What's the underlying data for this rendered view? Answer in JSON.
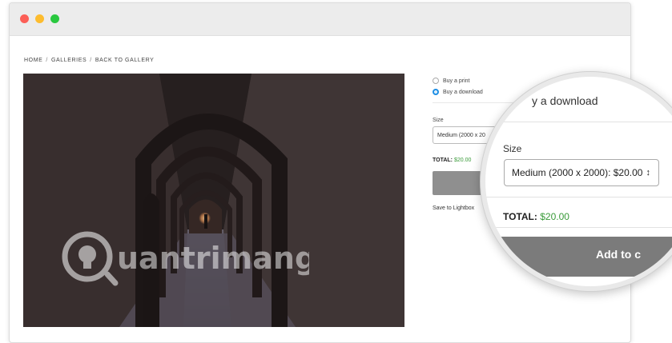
{
  "window": {
    "controls": [
      "close",
      "minimize",
      "maximize"
    ],
    "colors": {
      "close": "#fc5f57",
      "minimize": "#fdbc2e",
      "maximize": "#29c83f"
    }
  },
  "breadcrumb": {
    "items": [
      "HOME",
      "GALLERIES",
      "BACK TO GALLERY"
    ],
    "separator": "/"
  },
  "photo": {
    "icon": "archway-photo"
  },
  "purchase": {
    "options": [
      {
        "label": "Buy a print",
        "checked": false
      },
      {
        "label": "Buy a download",
        "checked": true
      }
    ],
    "size_label": "Size",
    "size_value": "Medium (2000 x 20",
    "total_label": "TOTAL:",
    "total_value": "$20.00",
    "save_link": "Save to Lightbox"
  },
  "magnifier": {
    "download_text": "y a download",
    "size_label": "Size",
    "size_value": "Medium (2000 x 2000): $20.00",
    "select_arrow": "↕",
    "total_label": "TOTAL:",
    "total_value": "$20.00",
    "add_button": "Add to c"
  },
  "watermark": {
    "text": "uantrimang",
    "icon": "lightbulb-q-icon"
  },
  "colors": {
    "accent": "#1f8fe5",
    "price": "#3a9b3a",
    "button": "#8f8f8f"
  }
}
